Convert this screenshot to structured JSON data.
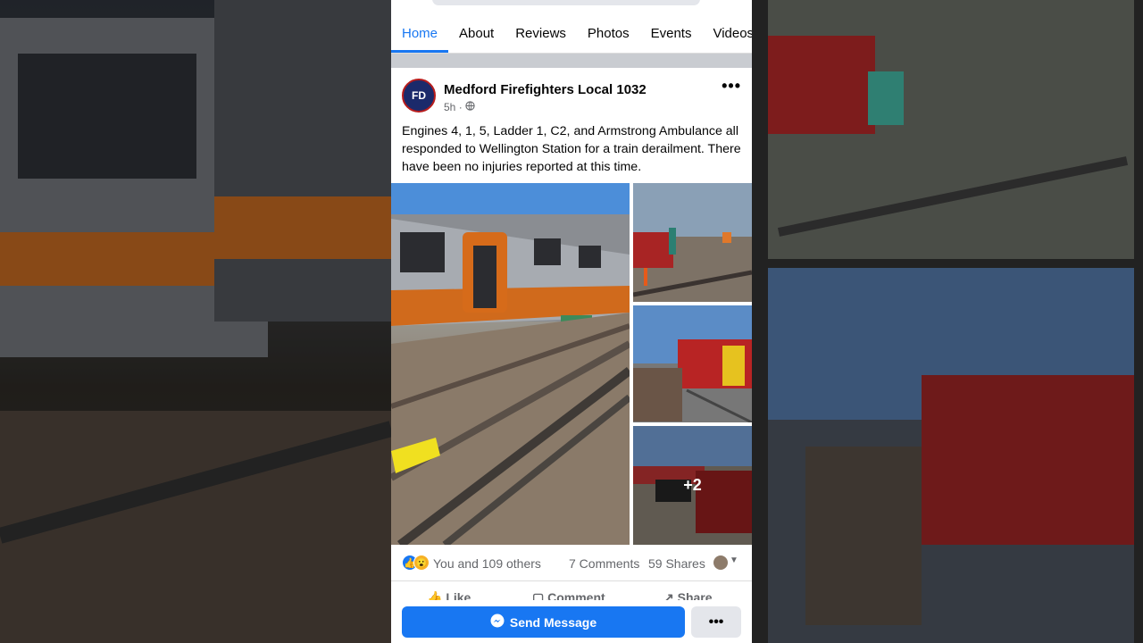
{
  "tabs": [
    {
      "label": "Home",
      "active": true
    },
    {
      "label": "About"
    },
    {
      "label": "Reviews"
    },
    {
      "label": "Photos"
    },
    {
      "label": "Events"
    },
    {
      "label": "Videos"
    }
  ],
  "post": {
    "author": "Medford Firefighters Local 1032",
    "avatar_text": "FD",
    "time": "5h",
    "privacy_icon": "globe-icon",
    "text": "Engines 4, 1, 5, Ladder 1, C2, and Armstrong Ambulance all responded to Wellington Station for a train derailment. There have been no injuries reported at this time.",
    "more_photos": "+2"
  },
  "reactions": {
    "text": "You and 109 others",
    "comments": "7 Comments",
    "shares": "59 Shares"
  },
  "actions": {
    "like": "Like",
    "comment": "Comment",
    "share": "Share"
  },
  "bottom": {
    "send_label": "Send Message",
    "more_label": "•••"
  },
  "colors": {
    "accent": "#1877f2",
    "train_orange": "#e06d1b"
  }
}
